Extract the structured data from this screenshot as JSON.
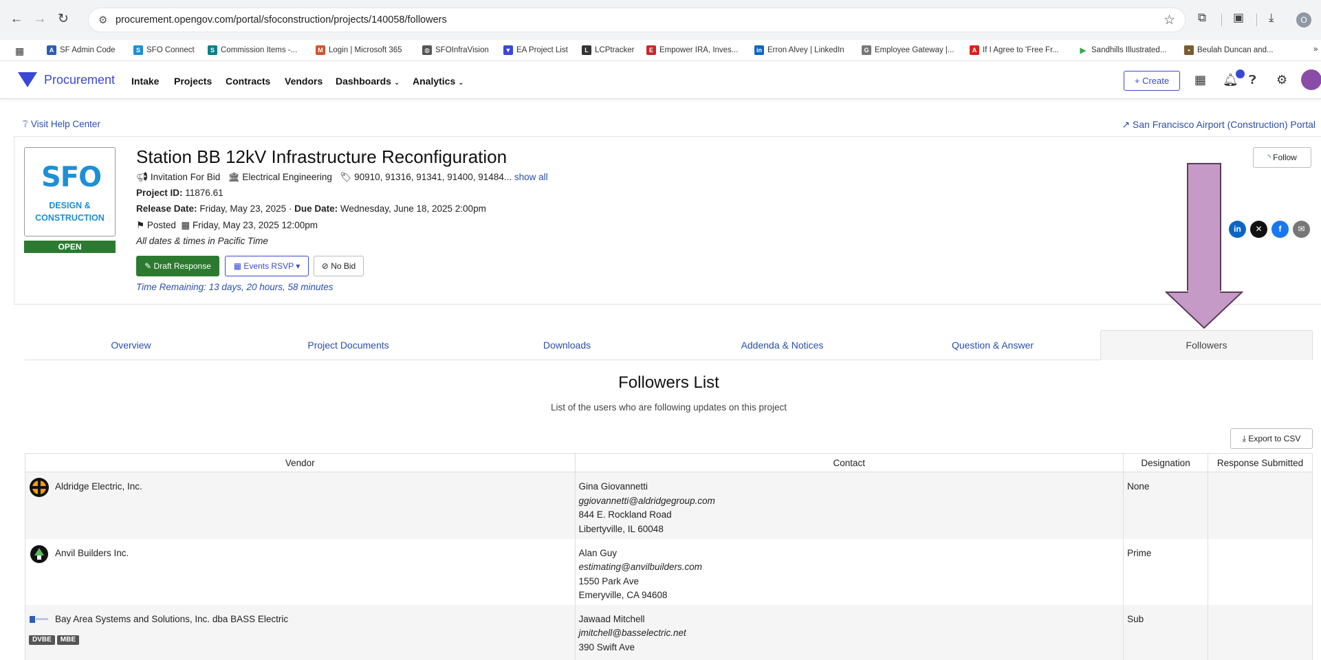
{
  "browser": {
    "url": "procurement.opengov.com/portal/sfoconstruction/projects/140058/followers",
    "profile_initial": "O",
    "bookmarks": [
      {
        "label": "SF Admin Code",
        "icon": "alp-icon",
        "color": "#2b5fb3"
      },
      {
        "label": "SFO Connect",
        "icon": "sfo-icon",
        "color": "#1d8fd6"
      },
      {
        "label": "Commission Items -...",
        "icon": "sharepoint-icon",
        "color": "#038387"
      },
      {
        "label": "Login | Microsoft 365",
        "icon": "ms365-icon",
        "color": "#d35230"
      },
      {
        "label": "SFOInfraVision",
        "icon": "globe-icon",
        "color": "#555555"
      },
      {
        "label": "EA Project List",
        "icon": "opengov-icon",
        "color": "#3a48d6"
      },
      {
        "label": "LCPtracker",
        "icon": "lcp-icon",
        "color": "#333333"
      },
      {
        "label": "Empower IRA, Inves...",
        "icon": "empower-icon",
        "color": "#c62828"
      },
      {
        "label": "Erron Alvey | LinkedIn",
        "icon": "linkedin-icon",
        "color": "#0a66c2"
      },
      {
        "label": "Employee Gateway |...",
        "icon": "gateway-icon",
        "color": "#777777"
      },
      {
        "label": "If I Agree to 'Free Fr...",
        "icon": "adobe-icon",
        "color": "#e0201b"
      },
      {
        "label": "Sandhills Illustrated...",
        "icon": "play-icon",
        "color": "#34a853"
      },
      {
        "label": "Beulah Duncan and...",
        "icon": "image-icon",
        "color": "#7a5c2e"
      }
    ]
  },
  "appnav": {
    "brand": "Procurement",
    "links": [
      "Intake",
      "Projects",
      "Contracts",
      "Vendors",
      "Dashboards",
      "Analytics"
    ],
    "create_label": "+ Create"
  },
  "help_link": "Visit Help Center",
  "portal_link": "San Francisco Airport (Construction) Portal",
  "project": {
    "logo_text": "SFO",
    "logo_sub1": "DESIGN &",
    "logo_sub2": "CONSTRUCTION",
    "status": "OPEN",
    "title": "Station BB 12kV Infrastructure Reconfiguration",
    "type": "Invitation For Bid",
    "department": "Electrical Engineering",
    "codes": "90910, 91316, 91341, 91400, 91484...",
    "show_all": "show all",
    "project_id_label": "Project ID:",
    "project_id": "11876.61",
    "release_label": "Release Date:",
    "release_date": "Friday, May 23, 2025",
    "due_label": "Due Date:",
    "due_date": "Wednesday, June 18, 2025 2:00pm",
    "posted_label": "Posted",
    "posted_date": "Friday, May 23, 2025 12:00pm",
    "timezone_note": "All dates & times in Pacific Time",
    "draft_btn": "Draft Response",
    "rsvp_btn": "Events RSVP",
    "nobid_btn": "No Bid",
    "time_remaining": "Time Remaining: 13 days, 20 hours, 58 minutes",
    "follow_btn": "Follow"
  },
  "tabs": [
    "Overview",
    "Project Documents",
    "Downloads",
    "Addenda & Notices",
    "Question & Answer",
    "Followers"
  ],
  "followers": {
    "title": "Followers List",
    "subtitle": "List of the users who are following updates on this project",
    "export_btn": "Export to CSV",
    "columns": [
      "Vendor",
      "Contact",
      "Designation",
      "Response Submitted"
    ],
    "rows": [
      {
        "vendor": "Aldridge Electric, Inc.",
        "contact_name": "Gina Giovannetti",
        "email": "ggiovannetti@aldridgegroup.com",
        "address1": "844 E. Rockland Road",
        "address2": "Libertyville, IL 60048",
        "designation": "None",
        "response": ""
      },
      {
        "vendor": "Anvil Builders Inc.",
        "contact_name": "Alan Guy",
        "email": "estimating@anvilbuilders.com",
        "address1": "1550 Park Ave",
        "address2": "Emeryville, CA 94608",
        "designation": "Prime",
        "response": ""
      },
      {
        "vendor": "Bay Area Systems and Solutions, Inc. dba BASS Electric",
        "badges": [
          "DVBE",
          "MBE"
        ],
        "contact_name": "Jawaad Mitchell",
        "email": "jmitchell@basselectric.net",
        "address1": "390 Swift Ave",
        "designation": "Sub",
        "response": ""
      }
    ]
  },
  "colors": {
    "brand": "#3a48d6",
    "open_green": "#2c7a2f",
    "link": "#2a4ea8",
    "annotation_arrow": "#c69ac6"
  }
}
